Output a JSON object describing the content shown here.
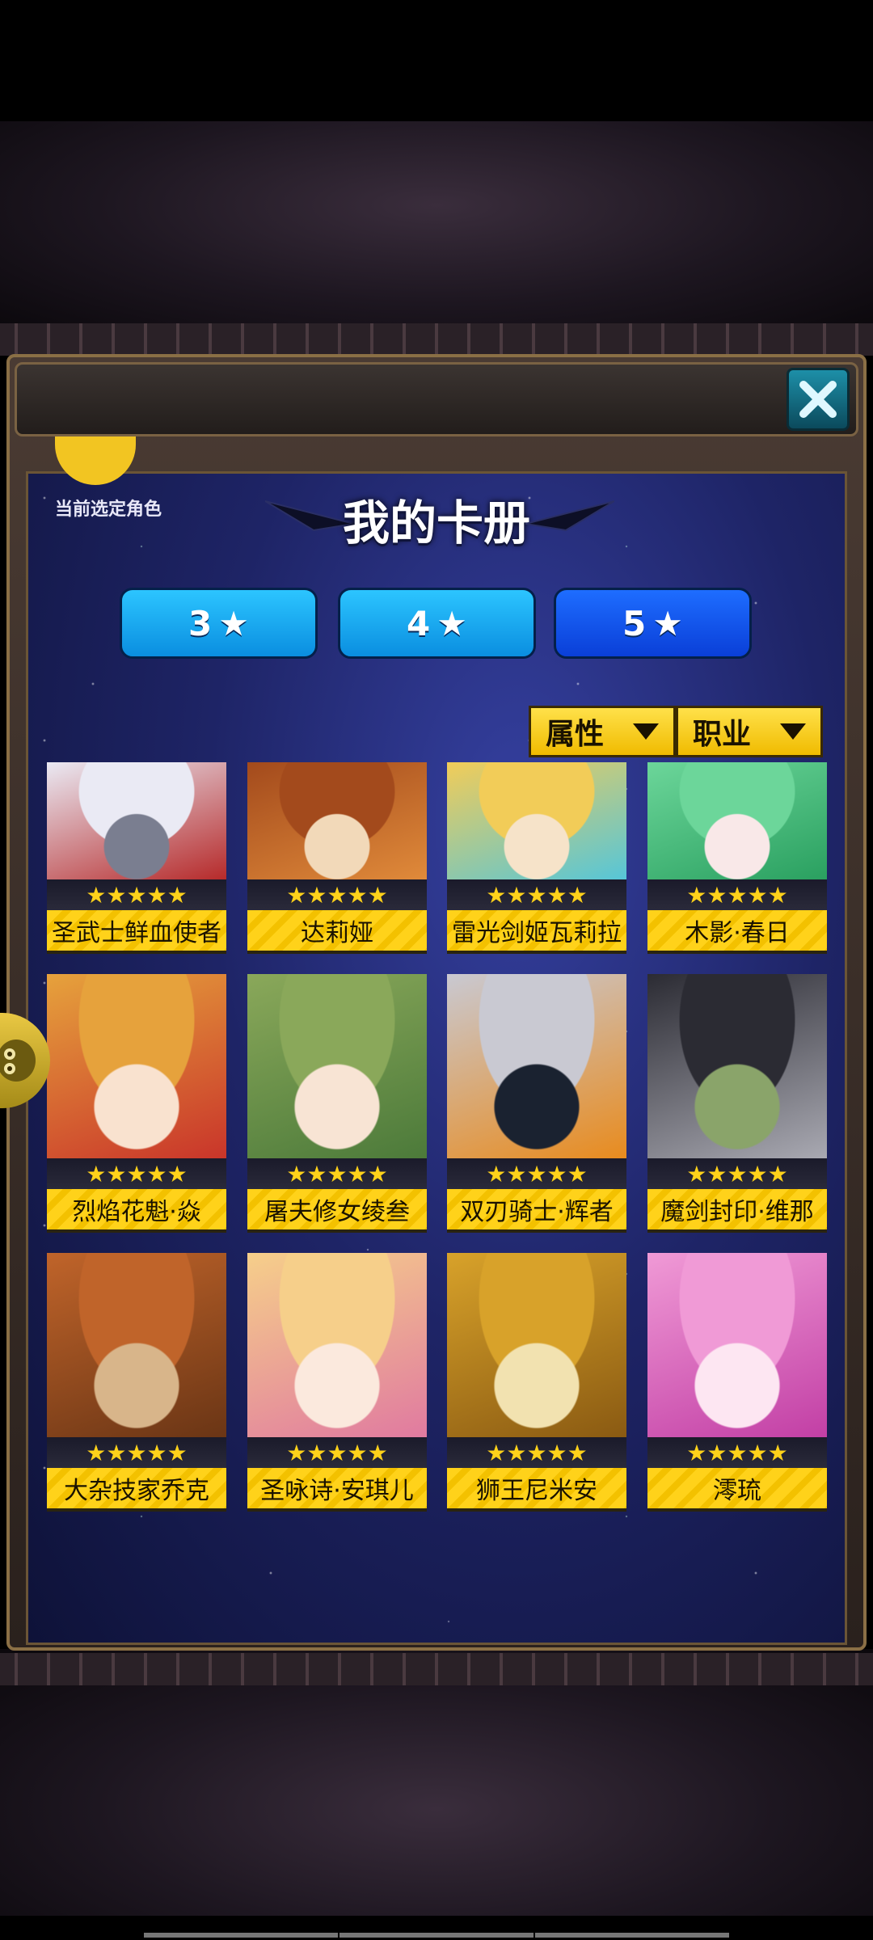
{
  "header": {
    "close_icon": "close-icon"
  },
  "selected": {
    "label": "当前选定角色"
  },
  "album": {
    "title": "我的卡册"
  },
  "tabs": [
    {
      "label": "3",
      "icon": "star-icon",
      "active": false
    },
    {
      "label": "4",
      "icon": "star-icon",
      "active": false
    },
    {
      "label": "5",
      "icon": "star-icon",
      "active": true
    }
  ],
  "filters": [
    {
      "label": "属性"
    },
    {
      "label": "职业"
    }
  ],
  "cards": [
    {
      "name": "圣武士鲜血使者",
      "stars": "★★★★★",
      "palette": [
        "#eaeaf4",
        "#b62a2a",
        "#7a7e90"
      ]
    },
    {
      "name": "达莉娅",
      "stars": "★★★★★",
      "palette": [
        "#a34a1c",
        "#e08a3a",
        "#f2d9b9"
      ]
    },
    {
      "name": "雷光剑姬瓦莉拉",
      "stars": "★★★★★",
      "palette": [
        "#f2cc58",
        "#56c6d8",
        "#f6e3c9"
      ]
    },
    {
      "name": "木影·春日",
      "stars": "★★★★★",
      "palette": [
        "#6cd69a",
        "#2aa060",
        "#f9e8e8"
      ]
    },
    {
      "name": "烈焰花魁·焱",
      "stars": "★★★★★",
      "palette": [
        "#e6a23c",
        "#c9352a",
        "#f9e2cf"
      ]
    },
    {
      "name": "屠夫修女绫叁",
      "stars": "★★★★★",
      "palette": [
        "#8aa85a",
        "#4c7a3a",
        "#f8e4d4"
      ]
    },
    {
      "name": "双刃骑士·辉者",
      "stars": "★★★★★",
      "palette": [
        "#c9c9d2",
        "#e88b1e",
        "#1a2230"
      ]
    },
    {
      "name": "魔剑封印·维那",
      "stars": "★★★★★",
      "palette": [
        "#2b2b33",
        "#a9a9b2",
        "#8aa46a"
      ]
    },
    {
      "name": "大杂技家乔克",
      "stars": "★★★★★",
      "palette": [
        "#c0642a",
        "#6a3515",
        "#d8b58a"
      ]
    },
    {
      "name": "圣咏诗·安琪儿",
      "stars": "★★★★★",
      "palette": [
        "#f6cf8a",
        "#e07aa0",
        "#fbe9dd"
      ]
    },
    {
      "name": "狮王尼米安",
      "stars": "★★★★★",
      "palette": [
        "#d8a22a",
        "#8a5a12",
        "#f2e2b0"
      ]
    },
    {
      "name": "澪琉",
      "stars": "★★★★★",
      "palette": [
        "#f09ad6",
        "#c23fa5",
        "#fde6f2"
      ]
    }
  ]
}
